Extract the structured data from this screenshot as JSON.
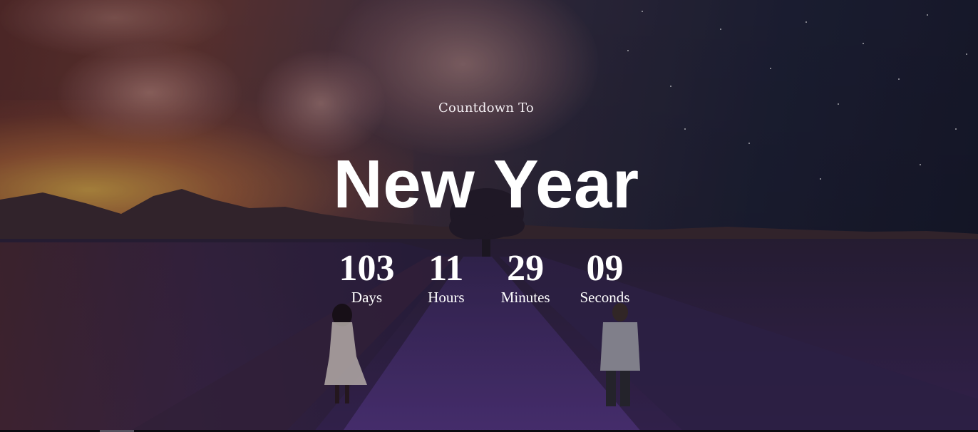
{
  "hero": {
    "pretitle": "Countdown To",
    "title": "New Year"
  },
  "countdown": [
    {
      "value": "103",
      "label": "Days"
    },
    {
      "value": "11",
      "label": "Hours"
    },
    {
      "value": "29",
      "label": "Minutes"
    },
    {
      "value": "09",
      "label": "Seconds"
    }
  ],
  "colors": {
    "text": "#ffffff",
    "lavender": "#4a2f6e",
    "sunset": "#d6aa46",
    "night_sky": "#171a2b"
  }
}
